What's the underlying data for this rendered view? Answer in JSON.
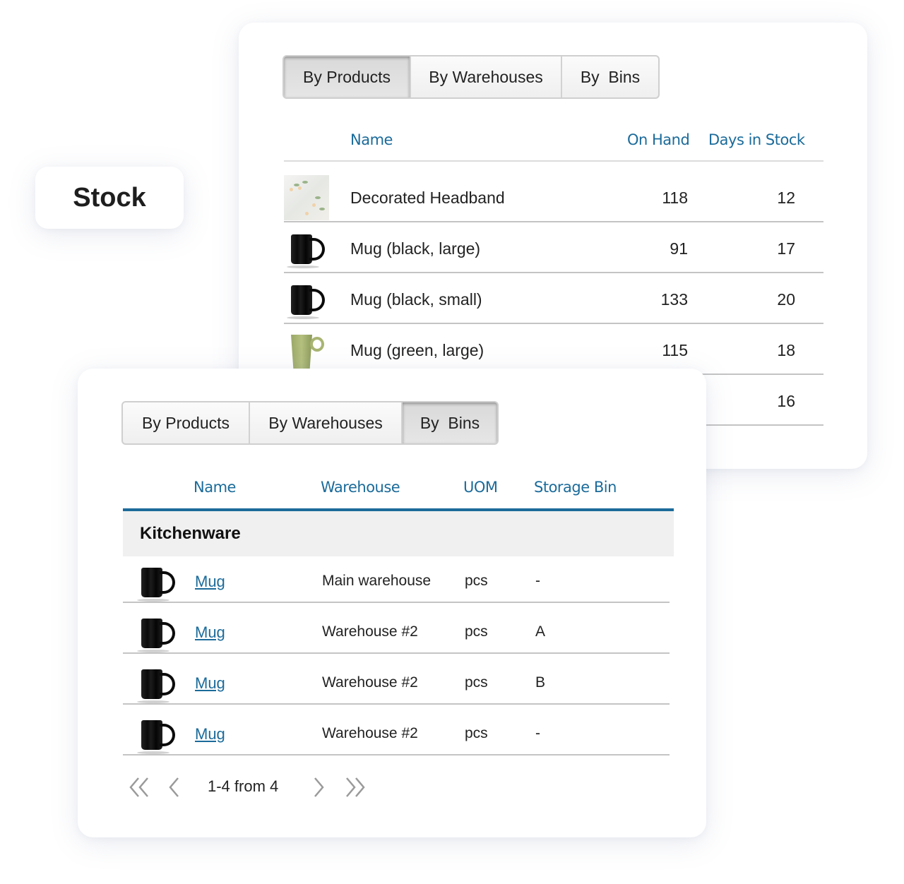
{
  "label": {
    "title": "Stock"
  },
  "products_view": {
    "tabs": [
      {
        "label": "By Products",
        "active": true
      },
      {
        "label": "By Warehouses",
        "active": false
      },
      {
        "label": "By  Bins",
        "active": false
      }
    ],
    "columns": {
      "name": "Name",
      "on_hand": "On Hand",
      "days_in_stock": "Days in Stock"
    },
    "rows": [
      {
        "image": "headband-thumbnail",
        "name": "Decorated Headband",
        "on_hand": "118",
        "days_in_stock": "12"
      },
      {
        "image": "black-mug-thumbnail",
        "name": "Mug (black, large)",
        "on_hand": "91",
        "days_in_stock": "17"
      },
      {
        "image": "black-mug-thumbnail",
        "name": "Mug (black, small)",
        "on_hand": "133",
        "days_in_stock": "20"
      },
      {
        "image": "green-mug-thumbnail",
        "name": "Mug (green, large)",
        "on_hand": "115",
        "days_in_stock": "18"
      },
      {
        "image": "",
        "name": "",
        "on_hand": "",
        "days_in_stock": "16"
      }
    ]
  },
  "bins_view": {
    "tabs": [
      {
        "label": "By Products",
        "active": false
      },
      {
        "label": "By Warehouses",
        "active": false
      },
      {
        "label": "By  Bins",
        "active": true
      }
    ],
    "columns": {
      "name": "Name",
      "warehouse": "Warehouse",
      "uom": "UOM",
      "storage_bin": "Storage Bin"
    },
    "group": "Kitchenware",
    "rows": [
      {
        "image": "black-mug-thumbnail",
        "name": "Mug",
        "warehouse": "Main warehouse",
        "uom": "pcs",
        "storage_bin": "-"
      },
      {
        "image": "black-mug-thumbnail",
        "name": "Mug",
        "warehouse": "Warehouse #2",
        "uom": "pcs",
        "storage_bin": "A"
      },
      {
        "image": "black-mug-thumbnail",
        "name": "Mug",
        "warehouse": "Warehouse #2",
        "uom": "pcs",
        "storage_bin": "B"
      },
      {
        "image": "black-mug-thumbnail",
        "name": "Mug",
        "warehouse": "Warehouse #2",
        "uom": "pcs",
        "storage_bin": "-"
      }
    ],
    "pagination": {
      "text": "1-4 from 4",
      "icons": [
        "first-page-icon",
        "previous-page-icon",
        "next-page-icon",
        "last-page-icon"
      ]
    }
  },
  "colors": {
    "accent": "#1b6b9a",
    "divider": "#c4c4c4",
    "group_bg": "#f0f0f0"
  }
}
